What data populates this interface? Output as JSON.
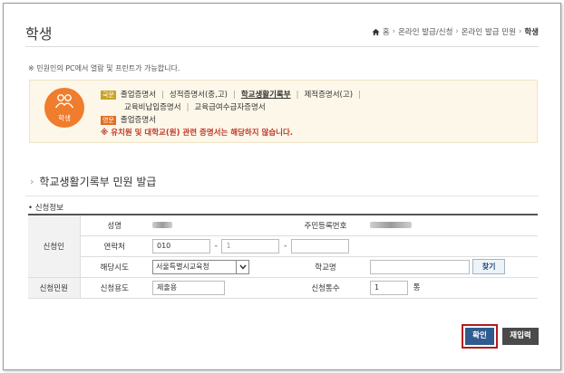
{
  "header": {
    "title": "학생",
    "breadcrumb": [
      "홈",
      "온라인 발급/신청",
      "온라인 발급 민원",
      "학생"
    ]
  },
  "notice": "※ 민원인의 PC에서 열람 및 프린트가 가능합니다.",
  "info": {
    "icon_label": "학생",
    "row1_tag": "국문",
    "row1_items": [
      "졸업증명서",
      "성적증명서(중,고)",
      "학교생활기록부",
      "제적증명서(고)"
    ],
    "row2_items": [
      "교육비납입증명서",
      "교육급여수급자증명서"
    ],
    "row3_tag": "영문",
    "row3_item": "졸업증명서",
    "warning": "※ 유치원 및 대학교(원) 관련 증명서는 해당하지 않습니다."
  },
  "section_title": "학교생활기록부 민원 발급",
  "sub_title": "신청정보",
  "form": {
    "applicant_label": "신청인",
    "name_label": "성명",
    "rrn_label": "주민등록번호",
    "contact_label": "연락처",
    "phone_prefix": "010",
    "phone_middle": "1",
    "dash": "-",
    "region_label": "해당시도",
    "region_value": "서울특별시교육청",
    "school_label": "학교명",
    "find_button": "찾기",
    "request_label": "신청민원",
    "purpose_label": "신청용도",
    "purpose_value": "제출용",
    "count_label": "신청통수",
    "count_value": "1",
    "count_unit": "통"
  },
  "buttons": {
    "confirm": "확인",
    "reset": "재입력"
  },
  "colors": {
    "accent_orange": "#ef7d2d",
    "confirm_blue": "#2f5b8f",
    "highlight_red": "#b31b1b",
    "warning_red": "#c0392b"
  }
}
